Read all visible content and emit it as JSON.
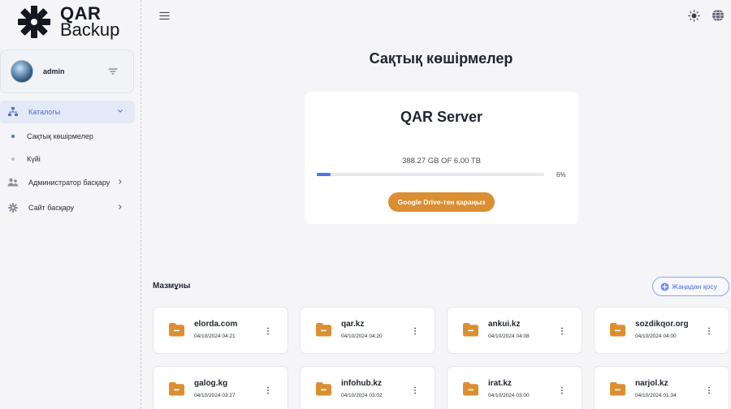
{
  "brand": {
    "line1": "QAR",
    "line2": "Backup"
  },
  "user": {
    "name": "admin"
  },
  "sidebar": {
    "items": [
      {
        "label": "Каталогы",
        "icon": "catalog-icon",
        "active": true,
        "expanded": true
      },
      {
        "label": "Администратор басқару",
        "icon": "admin-icon"
      },
      {
        "label": "Сайт басқару",
        "icon": "site-settings-icon"
      }
    ],
    "sub_items": [
      {
        "label": "Сақтық көшірмелер",
        "active": true
      },
      {
        "label": "Күйі"
      }
    ]
  },
  "page": {
    "title": "Сақтық көшірмелер"
  },
  "server": {
    "name": "QAR Server",
    "usage": "388.27 GB OF 6.00 TB",
    "percent_label": "6%",
    "percent": 6,
    "drive_button": "Google Drive-тен қараңыз"
  },
  "contents": {
    "title": "Мазмұны",
    "add_button": "Жаңадан қосу",
    "files": [
      {
        "name": "elorda.com",
        "date": "04/10/2024 04:21"
      },
      {
        "name": "qar.kz",
        "date": "04/10/2024 04:20"
      },
      {
        "name": "ankui.kz",
        "date": "04/10/2024 04:08"
      },
      {
        "name": "sozdikqor.org",
        "date": "04/10/2024 04:00"
      },
      {
        "name": "galog.kg",
        "date": "04/10/2024 03:27"
      },
      {
        "name": "infohub.kz",
        "date": "04/10/2024 03:02"
      },
      {
        "name": "irat.kz",
        "date": "04/10/2024 03:00"
      },
      {
        "name": "narjol.kz",
        "date": "04/10/2024 01:34"
      }
    ]
  },
  "colors": {
    "accent": "#4b6fd6",
    "folder": "#db8f31",
    "button": "#db8f31",
    "progress": "#4b74e6"
  }
}
